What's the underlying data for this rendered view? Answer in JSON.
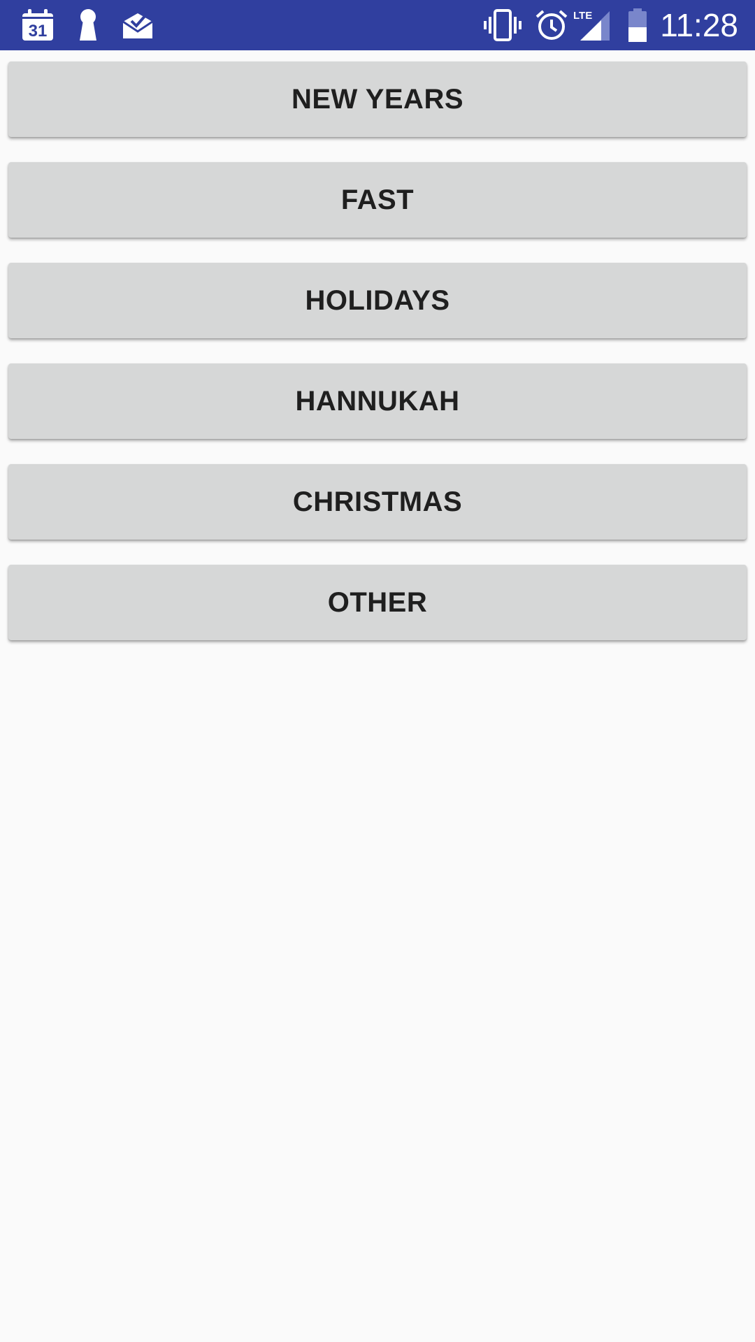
{
  "status_bar": {
    "background_color": "#303f9f",
    "time": "11:28",
    "calendar_day": "31",
    "left_icons": [
      "calendar-icon",
      "keyhole-icon",
      "mail-check-icon"
    ],
    "right_icons": [
      "vibrate-icon",
      "alarm-icon",
      "lte-signal-icon",
      "battery-icon"
    ],
    "network_label": "LTE"
  },
  "main": {
    "button_color": "#d6d7d7",
    "buttons": [
      {
        "label": "NEW YEARS"
      },
      {
        "label": "FAST"
      },
      {
        "label": "HOLIDAYS"
      },
      {
        "label": "HANNUKAH"
      },
      {
        "label": "CHRISTMAS"
      },
      {
        "label": "OTHER"
      }
    ]
  }
}
